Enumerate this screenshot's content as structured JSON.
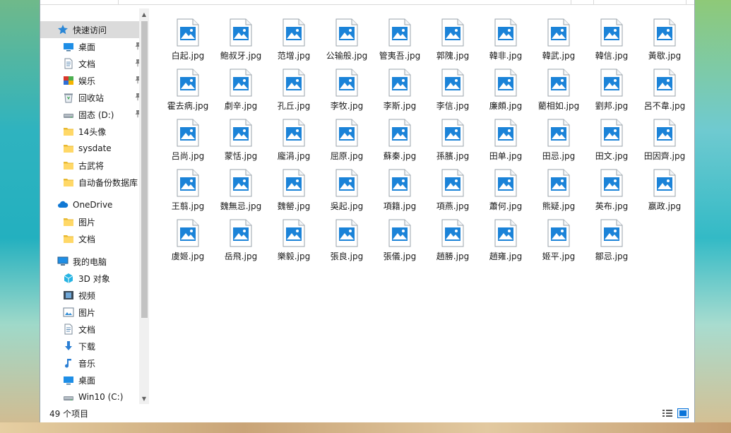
{
  "status": {
    "item_count": "49 个项目"
  },
  "nav": {
    "quick_access": "快速访问",
    "items": [
      {
        "label": "桌面",
        "icon": "desktop-icon",
        "pinned": true
      },
      {
        "label": "文档",
        "icon": "document-icon",
        "pinned": true
      },
      {
        "label": "娱乐",
        "icon": "app-icon",
        "pinned": true
      },
      {
        "label": "回收站",
        "icon": "recycle-bin-icon",
        "pinned": true
      },
      {
        "label": "固态 (D:)",
        "icon": "drive-icon",
        "pinned": true
      },
      {
        "label": "14头像",
        "icon": "folder-icon",
        "pinned": false
      },
      {
        "label": "sysdate",
        "icon": "folder-icon",
        "pinned": false
      },
      {
        "label": "古武将",
        "icon": "folder-icon",
        "pinned": false
      },
      {
        "label": "自动备份数据库",
        "icon": "folder-icon",
        "pinned": false
      }
    ],
    "onedrive": "OneDrive",
    "onedrive_items": [
      {
        "label": "图片",
        "icon": "folder-icon"
      },
      {
        "label": "文档",
        "icon": "folder-icon"
      }
    ],
    "this_pc": "我的电脑",
    "pc_items": [
      {
        "label": "3D 对象",
        "icon": "3d-objects-icon"
      },
      {
        "label": "视频",
        "icon": "video-icon"
      },
      {
        "label": "图片",
        "icon": "pictures-icon"
      },
      {
        "label": "文档",
        "icon": "document-icon"
      },
      {
        "label": "下载",
        "icon": "download-icon"
      },
      {
        "label": "音乐",
        "icon": "music-icon"
      },
      {
        "label": "桌面",
        "icon": "desktop-icon"
      },
      {
        "label": "Win10 (C:)",
        "icon": "drive-icon"
      }
    ]
  },
  "files": [
    "白起.jpg",
    "鲍叔牙.jpg",
    "范增.jpg",
    "公输般.jpg",
    "管夷吾.jpg",
    "郭隗.jpg",
    "韓非.jpg",
    "韓武.jpg",
    "韓信.jpg",
    "黃歇.jpg",
    "霍去病.jpg",
    "劇辛.jpg",
    "孔丘.jpg",
    "李牧.jpg",
    "李斯.jpg",
    "李信.jpg",
    "廉頗.jpg",
    "藺相如.jpg",
    "劉邦.jpg",
    "呂不韋.jpg",
    "吕尚.jpg",
    "蒙恬.jpg",
    "龐涓.jpg",
    "屈原.jpg",
    "蘇秦.jpg",
    "孫臏.jpg",
    "田单.jpg",
    "田忌.jpg",
    "田文.jpg",
    "田因齊.jpg",
    "王翦.jpg",
    "魏無忌.jpg",
    "魏罃.jpg",
    "吳起.jpg",
    "項籍.jpg",
    "項燕.jpg",
    "蕭何.jpg",
    "熊疑.jpg",
    "英布.jpg",
    "嬴政.jpg",
    "虞姬.jpg",
    "岳飛.jpg",
    "樂毅.jpg",
    "張良.jpg",
    "張儀.jpg",
    "趙勝.jpg",
    "趙雍.jpg",
    "姬平.jpg",
    "鄒忌.jpg"
  ],
  "colors": {
    "accent": "#0a74d9",
    "selected_bg": "#dbdbdb",
    "folder": "#ffd867"
  }
}
